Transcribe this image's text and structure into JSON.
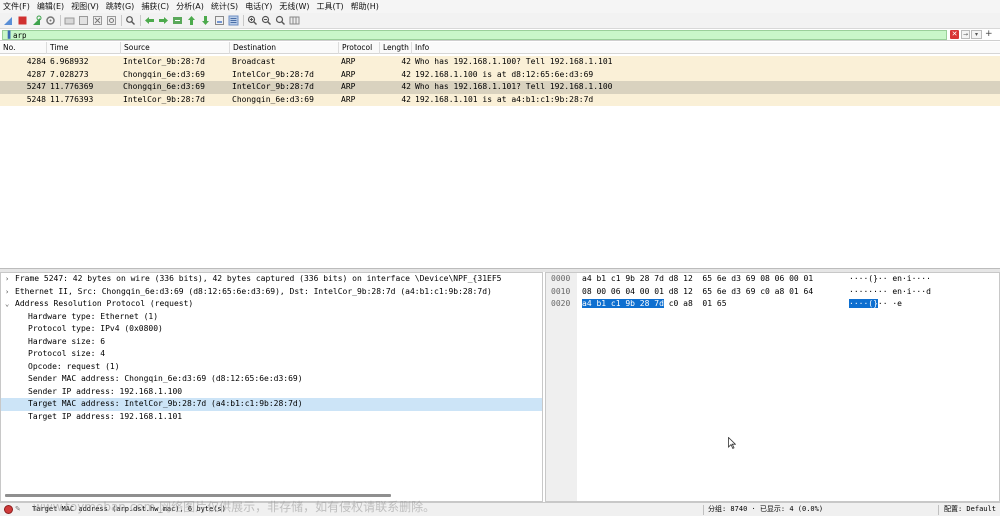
{
  "menu": [
    "文件(F)",
    "编辑(E)",
    "视图(V)",
    "跳转(G)",
    "捕获(C)",
    "分析(A)",
    "统计(S)",
    "电话(Y)",
    "无线(W)",
    "工具(T)",
    "帮助(H)"
  ],
  "colors": {
    "row_arp": "#faf0d7",
    "row_selected": "#d9d2bf",
    "detail_selected": "#cce4f7",
    "bytes_highlight": "#0e6fd0",
    "filter_bg": "#c9f7c9"
  },
  "toolbar_icons": [
    "shark-fin-start-icon",
    "stop-capture-icon",
    "restart-capture-icon",
    "capture-options-icon",
    "open-file-icon",
    "save-file-icon",
    "close-file-icon",
    "reload-file-icon",
    "find-packet-icon",
    "go-back-icon",
    "go-forward-icon",
    "go-to-packet-icon",
    "go-first-icon",
    "go-last-icon",
    "auto-scroll-icon",
    "colorize-icon",
    "zoom-in-icon",
    "zoom-out-icon",
    "zoom-normal-icon",
    "resize-columns-icon"
  ],
  "filter": {
    "value": "arp"
  },
  "columns": [
    "No.",
    "Time",
    "Source",
    "Destination",
    "Protocol",
    "Length",
    "Info"
  ],
  "packets": [
    {
      "no": "4284",
      "time": "6.968932",
      "src": "IntelCor_9b:28:7d",
      "dst": "Broadcast",
      "proto": "ARP",
      "len": "42",
      "info": "Who has 192.168.1.100? Tell 192.168.1.101",
      "selected": false
    },
    {
      "no": "4287",
      "time": "7.028273",
      "src": "Chongqin_6e:d3:69",
      "dst": "IntelCor_9b:28:7d",
      "proto": "ARP",
      "len": "42",
      "info": "192.168.1.100 is at d8:12:65:6e:d3:69",
      "selected": false
    },
    {
      "no": "5247",
      "time": "11.776369",
      "src": "Chongqin_6e:d3:69",
      "dst": "IntelCor_9b:28:7d",
      "proto": "ARP",
      "len": "42",
      "info": "Who has 192.168.1.101? Tell 192.168.1.100",
      "selected": true
    },
    {
      "no": "5248",
      "time": "11.776393",
      "src": "IntelCor_9b:28:7d",
      "dst": "Chongqin_6e:d3:69",
      "proto": "ARP",
      "len": "42",
      "info": "192.168.1.101 is at a4:b1:c1:9b:28:7d",
      "selected": false
    }
  ],
  "details": [
    {
      "text": "Frame 5247: 42 bytes on wire (336 bits), 42 bytes captured (336 bits) on interface \\Device\\NPF_{31EF5",
      "level": 0,
      "arrow": "›",
      "selected": false
    },
    {
      "text": "Ethernet II, Src: Chongqin_6e:d3:69 (d8:12:65:6e:d3:69), Dst: IntelCor_9b:28:7d (a4:b1:c1:9b:28:7d)",
      "level": 0,
      "arrow": "›",
      "selected": false
    },
    {
      "text": "Address Resolution Protocol (request)",
      "level": 0,
      "arrow": "⌄",
      "selected": false
    },
    {
      "text": "Hardware type: Ethernet (1)",
      "level": 1,
      "arrow": "",
      "selected": false
    },
    {
      "text": "Protocol type: IPv4 (0x0800)",
      "level": 1,
      "arrow": "",
      "selected": false
    },
    {
      "text": "Hardware size: 6",
      "level": 1,
      "arrow": "",
      "selected": false
    },
    {
      "text": "Protocol size: 4",
      "level": 1,
      "arrow": "",
      "selected": false
    },
    {
      "text": "Opcode: request (1)",
      "level": 1,
      "arrow": "",
      "selected": false
    },
    {
      "text": "Sender MAC address: Chongqin_6e:d3:69 (d8:12:65:6e:d3:69)",
      "level": 1,
      "arrow": "",
      "selected": false
    },
    {
      "text": "Sender IP address: 192.168.1.100",
      "level": 1,
      "arrow": "",
      "selected": false
    },
    {
      "text": "Target MAC address: IntelCor_9b:28:7d (a4:b1:c1:9b:28:7d)",
      "level": 1,
      "arrow": "",
      "selected": true
    },
    {
      "text": "Target IP address: 192.168.1.101",
      "level": 1,
      "arrow": "",
      "selected": false
    }
  ],
  "bytes": [
    {
      "offset": "0000",
      "hex": "a4 b1 c1 9b 28 7d d8 12  65 6e d3 69 08 06 00 01",
      "hex_hl": "",
      "hex_rest": "",
      "ascii": "····(}·· en·i····",
      "ascii_hl": "",
      "ascii_rest": ""
    },
    {
      "offset": "0010",
      "hex": "08 00 06 04 00 01 d8 12  65 6e d3 69 c0 a8 01 64",
      "hex_hl": "",
      "hex_rest": "",
      "ascii": "········ en·i···d",
      "ascii_hl": "",
      "ascii_rest": ""
    },
    {
      "offset": "0020",
      "hex": "",
      "hex_hl": "a4 b1 c1 9b 28 7d",
      "hex_rest": " c0 a8  01 65",
      "ascii": "",
      "ascii_hl": "····(}",
      "ascii_rest": "·· ·e"
    }
  ],
  "status": {
    "left": "Target MAC address (arp.dst.hw_mac), 6 byte(s)",
    "packets": "分组: 8740 · 已显示: 4 (0.0%)",
    "profile": "配置: Default"
  },
  "watermark": "www.toymoban.com 网络图片仅供展示，非存储，如有侵权请联系删除。"
}
